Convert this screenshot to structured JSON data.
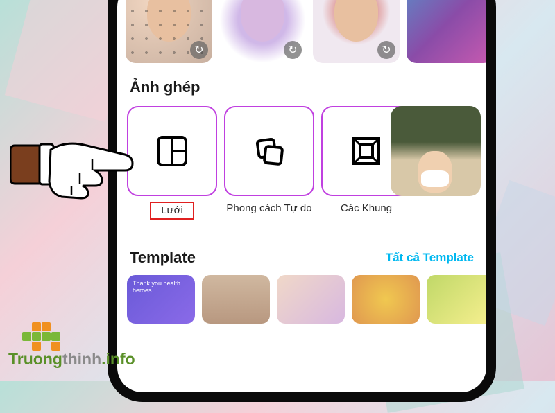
{
  "top_thumbs": {
    "refresh_glyph": "↻"
  },
  "sections": {
    "collage_title": "Ảnh ghép",
    "template_title": "Template",
    "template_all": "Tất cả Template"
  },
  "collage_options": [
    {
      "label": "Lưới",
      "highlighted": true
    },
    {
      "label": "Phong cách Tự do",
      "highlighted": false
    },
    {
      "label": "Các Khung",
      "highlighted": false
    }
  ],
  "template_card_text": "Thank you health heroes",
  "watermark": {
    "text_a": "Truong",
    "text_b": "thinh",
    "text_c": ".info"
  }
}
